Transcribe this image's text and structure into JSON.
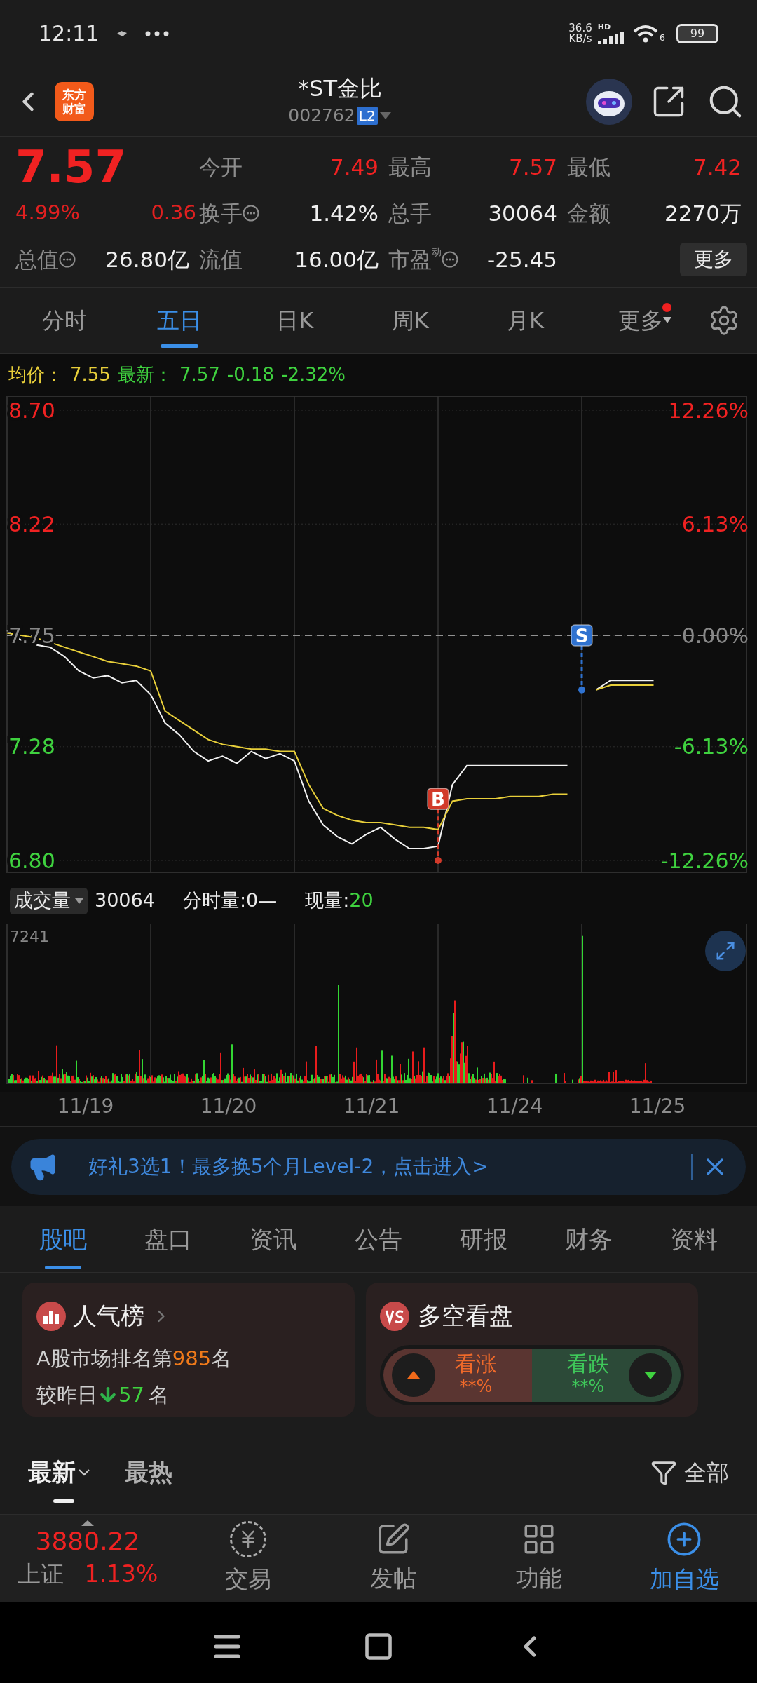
{
  "status_bar": {
    "time": "12:11",
    "net_speed": "36.6",
    "net_unit": "KB/s",
    "hd": "HD",
    "wifi_badge": "6",
    "battery": "99"
  },
  "header": {
    "logo": [
      "东方",
      "财富"
    ],
    "title": "*ST金比",
    "code": "002762",
    "level_badge": "L2"
  },
  "quote": {
    "price": "7.57",
    "change_pct": "4.99%",
    "change": "0.36",
    "more_button": "更多",
    "stats": [
      {
        "label": "今开",
        "value": "7.49",
        "color": "#f02222",
        "info": false
      },
      {
        "label": "最高",
        "value": "7.57",
        "color": "#f02222",
        "info": false
      },
      {
        "label": "最低",
        "value": "7.42",
        "color": "#f02222",
        "info": false
      },
      {
        "label": "换手",
        "value": "1.42%",
        "color": "#f0f0f0",
        "info": true
      },
      {
        "label": "总手",
        "value": "30064",
        "color": "#f0f0f0",
        "info": false
      },
      {
        "label": "金额",
        "value": "2270万",
        "color": "#f0f0f0",
        "info": false
      },
      {
        "label": "总值",
        "value": "26.80亿",
        "color": "#f0f0f0",
        "info": true
      },
      {
        "label": "流值",
        "value": "16.00亿",
        "color": "#f0f0f0",
        "info": false
      },
      {
        "label": "市盈",
        "sup": "动",
        "value": "-25.45",
        "color": "#f0f0f0",
        "info": true
      }
    ]
  },
  "chart_tabs": [
    {
      "label": "分时",
      "selected": false,
      "dot": false
    },
    {
      "label": "五日",
      "selected": true,
      "dot": false
    },
    {
      "label": "日K",
      "selected": false,
      "dot": false
    },
    {
      "label": "周K",
      "selected": false,
      "dot": false
    },
    {
      "label": "月K",
      "selected": false,
      "dot": false
    },
    {
      "label": "更多",
      "selected": false,
      "dot": true
    }
  ],
  "price_chart": {
    "legend": [
      {
        "text": "均价：",
        "color": "#e8cf3a"
      },
      {
        "text": "7.55",
        "color": "#e8cf3a"
      },
      {
        "text": "最新：",
        "color": "#3fd23f"
      },
      {
        "text": "7.57",
        "color": "#3fd23f"
      },
      {
        "text": "-0.18",
        "color": "#3fd23f"
      },
      {
        "text": "-2.32%",
        "color": "#3fd23f"
      }
    ],
    "percent_labels": [
      {
        "text": "12.26%",
        "color": "#f02222"
      },
      {
        "text": "6.13%",
        "color": "#f02222"
      },
      {
        "text": "0.00%",
        "color": "#888888"
      },
      {
        "text": "-6.13%",
        "color": "#3fd23f"
      },
      {
        "text": "-12.26%",
        "color": "#3fd23f"
      }
    ],
    "trade_marks": [
      {
        "kind": "buy",
        "label": "B"
      },
      {
        "kind": "sell",
        "label": "S"
      }
    ],
    "chart_data": {
      "type": "line",
      "ylim": [
        6.8,
        8.7
      ],
      "grid": true,
      "ref_lines": [
        {
          "axis": "y",
          "value": 7.75
        }
      ],
      "yticks": [
        {
          "value": 8.7,
          "label": "8.70"
        },
        {
          "value": 8.22,
          "label": "8.22"
        },
        {
          "value": 7.75,
          "label": "7.75"
        },
        {
          "value": 7.28,
          "label": "7.28"
        },
        {
          "value": 6.8,
          "label": "6.80"
        }
      ],
      "categories": [
        null,
        null,
        null,
        null,
        null,
        null,
        null,
        null,
        null,
        null,
        null,
        null,
        null,
        null,
        null,
        null,
        null,
        null,
        null,
        null,
        null,
        null,
        null,
        null,
        null,
        null,
        null,
        null,
        null,
        null,
        null,
        null,
        null,
        null,
        null,
        null,
        null,
        null,
        null,
        null,
        null,
        null,
        null,
        null,
        null,
        null
      ],
      "series": [
        {
          "color": "#f2f2f2",
          "values": [
            7.77,
            7.73,
            7.71,
            7.7,
            7.66,
            7.6,
            7.57,
            7.58,
            7.55,
            7.56,
            7.5,
            7.38,
            7.33,
            7.26,
            7.22,
            7.24,
            7.21,
            7.26,
            7.23,
            7.25,
            7.22,
            7.05,
            6.95,
            6.9,
            6.87,
            6.91,
            6.94,
            6.89,
            6.85,
            6.85,
            6.86,
            7.12,
            7.2,
            7.2,
            7.2,
            7.2,
            7.2,
            7.2,
            7.2,
            7.2,
            null,
            null,
            null,
            null,
            null,
            null
          ]
        },
        {
          "color": "#e8cf3a",
          "values": [
            7.76,
            7.75,
            7.74,
            7.72,
            7.7,
            7.68,
            7.66,
            7.64,
            7.63,
            7.62,
            7.6,
            7.43,
            7.39,
            7.35,
            7.31,
            7.29,
            7.28,
            7.27,
            7.27,
            7.26,
            7.26,
            7.12,
            7.02,
            6.99,
            6.97,
            6.96,
            6.96,
            6.95,
            6.94,
            6.94,
            6.93,
            7.05,
            7.06,
            7.06,
            7.06,
            7.07,
            7.07,
            7.07,
            7.08,
            7.08,
            null,
            null,
            null,
            null,
            null,
            null
          ]
        },
        {
          "color": "#f2f2f2",
          "values": [
            null,
            null,
            null,
            null,
            null,
            null,
            null,
            null,
            null,
            null,
            null,
            null,
            null,
            null,
            null,
            null,
            null,
            null,
            null,
            null,
            null,
            null,
            null,
            null,
            null,
            null,
            null,
            null,
            null,
            null,
            null,
            null,
            null,
            null,
            null,
            null,
            null,
            null,
            null,
            null,
            null,
            7.52,
            7.56,
            7.56,
            7.56,
            7.56
          ]
        },
        {
          "color": "#e8cf3a",
          "values": [
            null,
            null,
            null,
            null,
            null,
            null,
            null,
            null,
            null,
            null,
            null,
            null,
            null,
            null,
            null,
            null,
            null,
            null,
            null,
            null,
            null,
            null,
            null,
            null,
            null,
            null,
            null,
            null,
            null,
            null,
            null,
            null,
            null,
            null,
            null,
            null,
            null,
            null,
            null,
            null,
            null,
            7.52,
            7.54,
            7.54,
            7.54,
            7.54
          ]
        }
      ]
    }
  },
  "volume": {
    "selector": "成交量",
    "total": "30064",
    "minute_volume": "分时量:0—",
    "current_label": "现量:",
    "current_value": "20",
    "max_label": "7241",
    "dates": [
      "11/19",
      "11/20",
      "11/21",
      "11/24",
      "11/25"
    ]
  },
  "banner": {
    "text": "好礼3选1！最多换5个月Level-2，点击进入>"
  },
  "section_tabs": [
    {
      "label": "股吧",
      "selected": true
    },
    {
      "label": "盘口",
      "selected": false
    },
    {
      "label": "资讯",
      "selected": false
    },
    {
      "label": "公告",
      "selected": false
    },
    {
      "label": "研报",
      "selected": false
    },
    {
      "label": "财务",
      "selected": false
    },
    {
      "label": "资料",
      "selected": false
    }
  ],
  "popularity_card": {
    "title": "人气榜",
    "rank_prefix": "A股市场排名第",
    "rank": "985",
    "rank_suffix": "名",
    "change_label": "较昨日",
    "change_down": true,
    "change_value": "57",
    "change_unit": "名"
  },
  "vote_card": {
    "title": "多空看盘",
    "bull_label": "看涨",
    "bull_value": "**%",
    "bear_label": "看跌",
    "bear_value": "**%"
  },
  "sort_tabs": [
    {
      "label": "最新",
      "selected": true
    },
    {
      "label": "最热",
      "selected": false
    }
  ],
  "filter": {
    "label": "全部"
  },
  "bottom_bar": {
    "index": {
      "value": "3880.22",
      "name": "上证",
      "change": "1.13%",
      "color": "#f02222"
    },
    "items": [
      {
        "kind": "trade",
        "label": "交易",
        "active": false
      },
      {
        "kind": "post",
        "label": "发帖",
        "active": false
      },
      {
        "kind": "functions",
        "label": "功能",
        "active": false
      },
      {
        "kind": "watchlist",
        "label": "加自选",
        "active": true
      }
    ]
  }
}
